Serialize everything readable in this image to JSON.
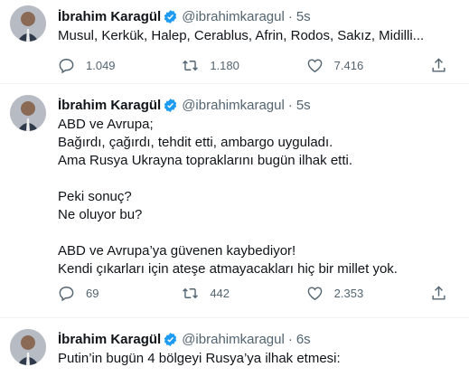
{
  "colors": {
    "text": "#0f1419",
    "secondary": "#536471",
    "verified": "#1d9bf0",
    "divider": "#eff3f4"
  },
  "tweets": [
    {
      "name": "İbrahim Karagül",
      "handle": "@ibrahimkaragul",
      "time": "5s",
      "text": "Musul, Kerkük, Halep, Cerablus, Afrin, Rodos, Sakız, Midilli...",
      "replies": "1.049",
      "retweets": "1.180",
      "likes": "7.416"
    },
    {
      "name": "İbrahim Karagül",
      "handle": "@ibrahimkaragul",
      "time": "5s",
      "text": "ABD ve Avrupa;\nBağırdı, çağırdı, tehdit etti, ambargo uyguladı.\nAma Rusya Ukrayna topraklarını bugün ilhak etti.\n\nPeki sonuç?\nNe oluyor bu?\n\nABD ve Avrupa’ya güvenen kaybediyor!\nKendi çıkarları için ateşe atmayacakları hiç bir millet yok.",
      "replies": "69",
      "retweets": "442",
      "likes": "2.353"
    },
    {
      "name": "İbrahim Karagül",
      "handle": "@ibrahimkaragul",
      "time": "6s",
      "text": "Putin’in bugün 4 bölgeyi Rusya’ya ilhak etmesi:"
    }
  ],
  "icons": {
    "reply": "reply-icon",
    "retweet": "retweet-icon",
    "like": "like-icon",
    "share": "share-icon",
    "verified": "verified-badge-icon"
  }
}
